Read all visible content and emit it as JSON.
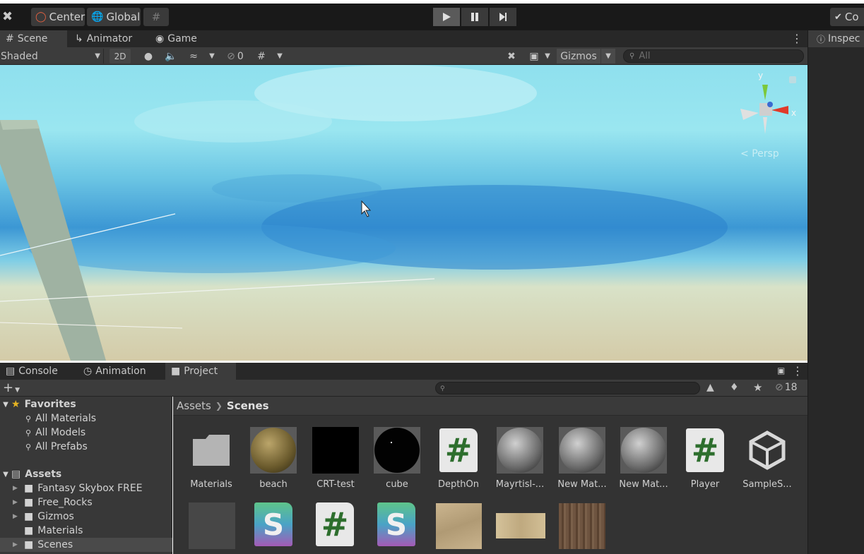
{
  "toolbar": {
    "pivot_label": "Center",
    "space_label": "Global",
    "right_label": "Co"
  },
  "scene_tabs": [
    {
      "label": "Scene",
      "icon": "grid-icon"
    },
    {
      "label": "Animator",
      "icon": "animator-icon"
    },
    {
      "label": "Game",
      "icon": "gamepad-icon"
    }
  ],
  "scene_toolbar": {
    "draw_mode": "Shaded",
    "mode_2d": "2D",
    "hidden_count": "0",
    "gizmos_label": "Gizmos",
    "search_placeholder": "All"
  },
  "viewport": {
    "axis_y": "y",
    "axis_x": "x",
    "projection_label": "Persp"
  },
  "inspector": {
    "tab_label": "Inspec"
  },
  "bottom_tabs": [
    {
      "label": "Console"
    },
    {
      "label": "Animation"
    },
    {
      "label": "Project"
    }
  ],
  "project_toolbar": {
    "hidden_packages_count": "18"
  },
  "tree": {
    "favorites_label": "Favorites",
    "favorites": [
      "All Materials",
      "All Models",
      "All Prefabs"
    ],
    "assets_label": "Assets",
    "folders": [
      {
        "label": "Fantasy Skybox FREE",
        "expandable": true
      },
      {
        "label": "Free_Rocks",
        "expandable": true
      },
      {
        "label": "Gizmos",
        "expandable": true
      },
      {
        "label": "Materials",
        "expandable": false
      },
      {
        "label": "Scenes",
        "expandable": true
      }
    ]
  },
  "breadcrumb": {
    "root": "Assets",
    "current": "Scenes"
  },
  "assets_row1": [
    {
      "label": "Materials",
      "kind": "folder"
    },
    {
      "label": "beach",
      "kind": "material"
    },
    {
      "label": "CRT-test",
      "kind": "black-square"
    },
    {
      "label": "cube",
      "kind": "black-sphere"
    },
    {
      "label": "DepthOn",
      "kind": "script"
    },
    {
      "label": "Mayrtisl-...",
      "kind": "grey-sphere"
    },
    {
      "label": "New Mat...",
      "kind": "grey-sphere"
    },
    {
      "label": "New Mat...",
      "kind": "grey-sphere"
    },
    {
      "label": "Player",
      "kind": "script"
    },
    {
      "label": "SampleS...",
      "kind": "unity-scene"
    }
  ]
}
